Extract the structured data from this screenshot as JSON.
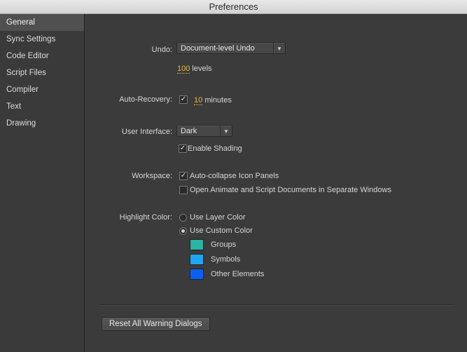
{
  "window": {
    "title": "Preferences"
  },
  "sidebar": {
    "items": [
      {
        "label": "General"
      },
      {
        "label": "Sync Settings"
      },
      {
        "label": "Code Editor"
      },
      {
        "label": "Script Files"
      },
      {
        "label": "Compiler"
      },
      {
        "label": "Text"
      },
      {
        "label": "Drawing"
      }
    ],
    "selected": "General"
  },
  "undo": {
    "label": "Undo:",
    "selected": "Document-level Undo",
    "levels_value": "100",
    "levels_suffix": "levels"
  },
  "auto_recovery": {
    "label": "Auto-Recovery:",
    "checked": true,
    "value": "10",
    "suffix": "minutes"
  },
  "user_interface": {
    "label": "User Interface:",
    "selected": "Dark",
    "enable_shading_label": "Enable Shading",
    "enable_shading_checked": true
  },
  "workspace": {
    "label": "Workspace:",
    "auto_collapse_label": "Auto-collapse Icon Panels",
    "auto_collapse_checked": true,
    "separate_windows_label": "Open Animate and Script Documents in Separate Windows",
    "separate_windows_checked": false
  },
  "highlight": {
    "label": "Highlight Color:",
    "use_layer_label": "Use Layer Color",
    "use_custom_label": "Use Custom Color",
    "selected": "Use Custom Color",
    "swatches": [
      {
        "label": "Groups",
        "color": "#2bb3a3"
      },
      {
        "label": "Symbols",
        "color": "#1fa6f2"
      },
      {
        "label": "Other Elements",
        "color": "#0b5ff0"
      }
    ]
  },
  "footer": {
    "reset_label": "Reset All Warning Dialogs"
  }
}
